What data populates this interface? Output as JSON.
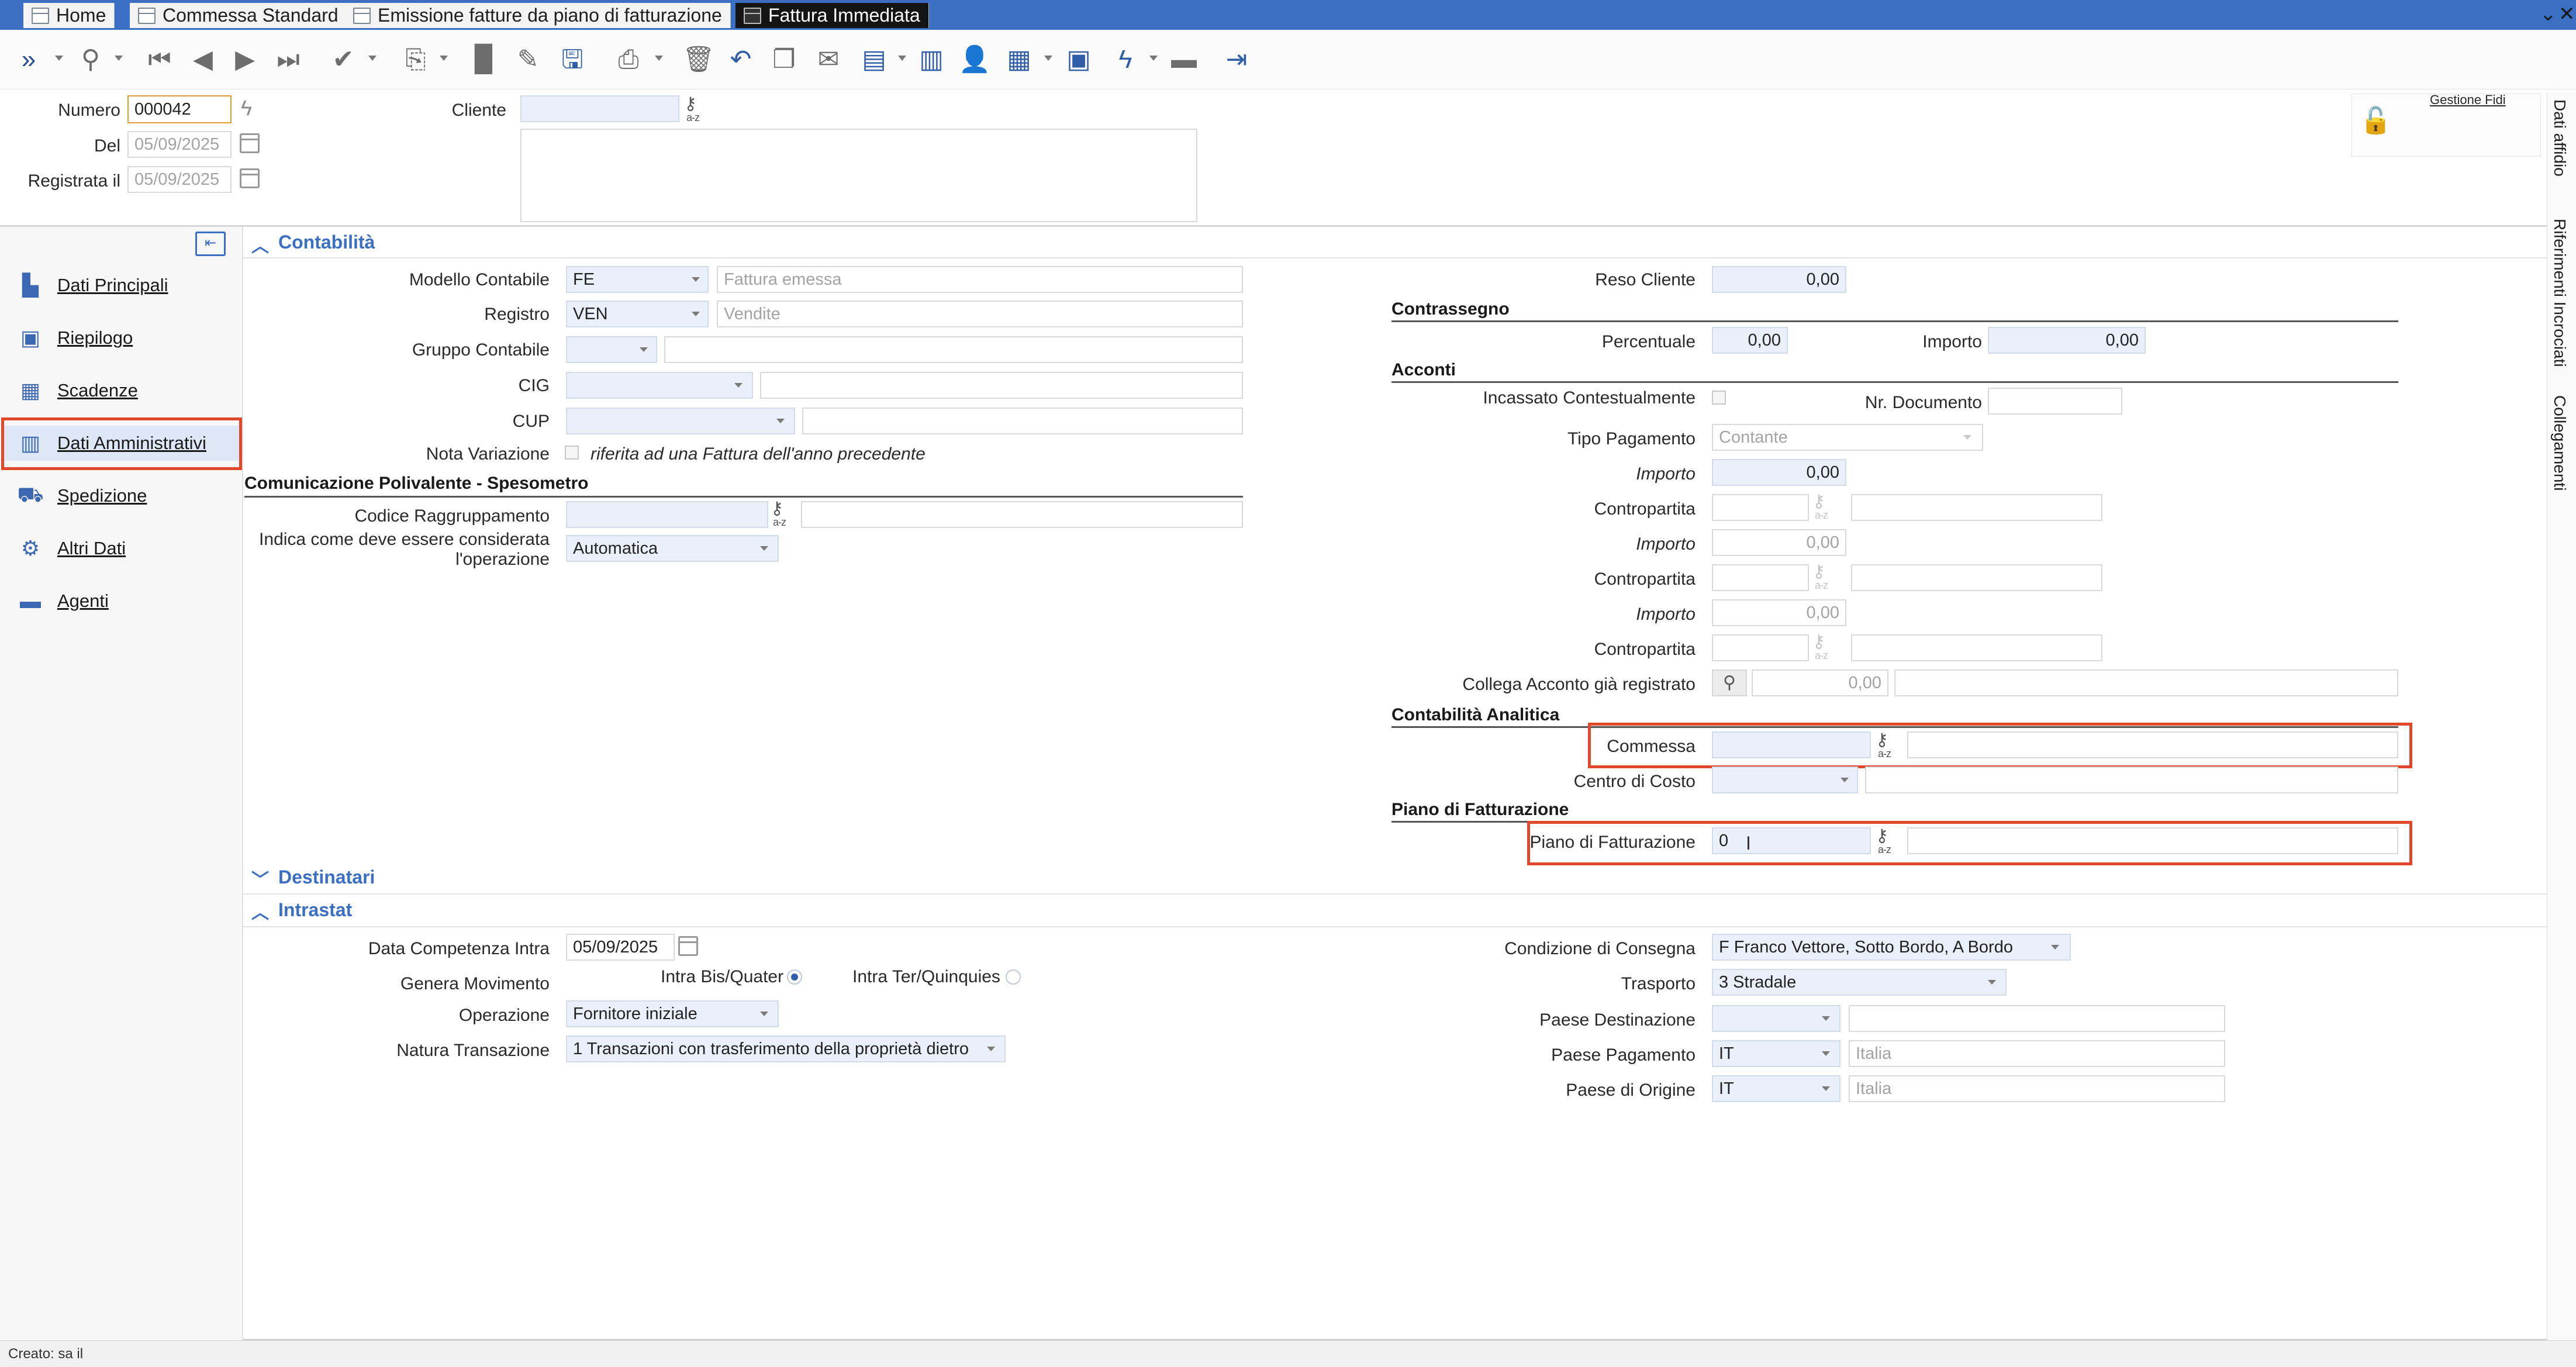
{
  "tabs": [
    {
      "label": "Home",
      "active": false
    },
    {
      "label": "Commessa Standard",
      "active": false
    },
    {
      "label": "Emissione fatture da piano di fatturazione",
      "active": false
    },
    {
      "label": "Fattura Immediata",
      "active": true
    }
  ],
  "window_controls": {
    "menu": "⌄",
    "close": "✕"
  },
  "toolbar_icons": [
    "expand-icon",
    "search-icon",
    "first-record-icon",
    "previous-record-icon",
    "next-record-icon",
    "last-record-icon",
    "approve-icon",
    "copy-document-icon",
    "new-document-icon",
    "edit-icon",
    "save-icon",
    "print-icon",
    "delete-icon",
    "undo-icon",
    "duplicate-icon",
    "email-icon",
    "report-icon",
    "columns-icon",
    "user-icon",
    "grid-icon",
    "calendar-icon",
    "lightning-icon",
    "briefcase-icon",
    "exit-icon"
  ],
  "header": {
    "numero_label": "Numero",
    "numero_value": "000042",
    "del_label": "Del",
    "del_value": "05/09/2025",
    "registrata_label": "Registrata il",
    "registrata_value": "05/09/2025",
    "cliente_label": "Cliente",
    "cliente_value": "",
    "gestione_fidi": "Gestione Fidi"
  },
  "right_side_tabs": [
    "Dati affidio",
    "Riferimenti Incrociati",
    "Collegamenti"
  ],
  "nav": [
    {
      "label": "Dati Principali",
      "icon": "person-doc-icon",
      "selected": false
    },
    {
      "label": "Riepilogo",
      "icon": "summary-icon",
      "selected": false
    },
    {
      "label": "Scadenze",
      "icon": "calendar-icon",
      "selected": false
    },
    {
      "label": "Dati Amministrativi",
      "icon": "admin-chart-icon",
      "selected": true
    },
    {
      "label": "Spedizione",
      "icon": "shipping-icon",
      "selected": false
    },
    {
      "label": "Altri Dati",
      "icon": "other-data-icon",
      "selected": false
    },
    {
      "label": "Agenti",
      "icon": "agents-icon",
      "selected": false
    }
  ],
  "contabilita": {
    "title": "Contabilità",
    "modello_label": "Modello Contabile",
    "modello_code": "FE",
    "modello_desc": "Fattura emessa",
    "registro_label": "Registro",
    "registro_code": "VEN",
    "registro_desc": "Vendite",
    "gruppo_label": "Gruppo Contabile",
    "cig_label": "CIG",
    "cup_label": "CUP",
    "nota_label": "Nota Variazione",
    "nota_text": "riferita ad una Fattura dell'anno precedente",
    "comunicazione_title": "Comunicazione Polivalente - Spesometro",
    "codice_label": "Codice Raggruppamento",
    "indica_label_1": "Indica come deve essere considerata",
    "indica_label_2": "l'operazione",
    "indica_value": "Automatica",
    "reso_label": "Reso Cliente",
    "reso_value": "0,00",
    "contrassegno_title": "Contrassegno",
    "percentuale_label": "Percentuale",
    "percentuale_value": "0,00",
    "importo_label": "Importo",
    "importo_value": "0,00",
    "acconti_title": "Acconti",
    "incassato_label": "Incassato Contestualmente",
    "nr_documento_label": "Nr. Documento",
    "tipo_pagamento_label": "Tipo Pagamento",
    "tipo_pagamento_value": "Contante",
    "importo1_label": "Importo",
    "importo1_value": "0,00",
    "contropartita1_label": "Contropartita",
    "importo2_label": "Importo",
    "importo2_value": "0,00",
    "contropartita2_label": "Contropartita",
    "importo3_label": "Importo",
    "importo3_value": "0,00",
    "contropartita3_label": "Contropartita",
    "collega_label": "Collega Acconto già registrato",
    "collega_value": "0,00",
    "analitica_title": "Contabilità Analitica",
    "commessa_label": "Commessa",
    "centro_costo_label": "Centro di Costo",
    "piano_title": "Piano di Fatturazione",
    "piano_label": "Piano di Fatturazione",
    "piano_value": "0"
  },
  "destinatari": {
    "title": "Destinatari"
  },
  "intrastat": {
    "title": "Intrastat",
    "data_label": "Data Competenza Intra",
    "data_value": "05/09/2025",
    "genera_label": "Genera Movimento",
    "radio1_label": "Intra Bis/Quater",
    "radio2_label": "Intra Ter/Quinquies",
    "operazione_label": "Operazione",
    "operazione_value": "Fornitore iniziale",
    "natura_label": "Natura Transazione",
    "natura_value": "1  Transazioni con trasferimento della proprietà dietro",
    "condizione_label": "Condizione di Consegna",
    "condizione_value": "F  Franco Vettore, Sotto Bordo, A Bordo",
    "trasporto_label": "Trasporto",
    "trasporto_value": "3 Stradale",
    "paese_dest_label": "Paese Destinazione",
    "paese_pag_label": "Paese Pagamento",
    "paese_pag_code": "IT",
    "paese_pag_desc": "Italia",
    "paese_orig_label": "Paese di Origine",
    "paese_orig_code": "IT",
    "paese_orig_desc": "Italia"
  },
  "status_bar": {
    "text": "Creato: sa il"
  }
}
